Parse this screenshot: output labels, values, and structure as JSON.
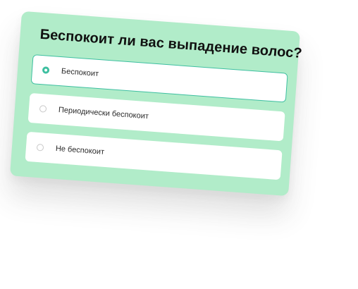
{
  "survey": {
    "question": "Беспокоит ли вас выпадение волос?",
    "options": [
      {
        "label": "Беспокоит",
        "selected": true
      },
      {
        "label": "Периодически беспокоит",
        "selected": false
      },
      {
        "label": "Не беспокоит",
        "selected": false
      }
    ]
  },
  "colors": {
    "card_background": "#b1ecc9",
    "accent": "#3dbfa0"
  }
}
